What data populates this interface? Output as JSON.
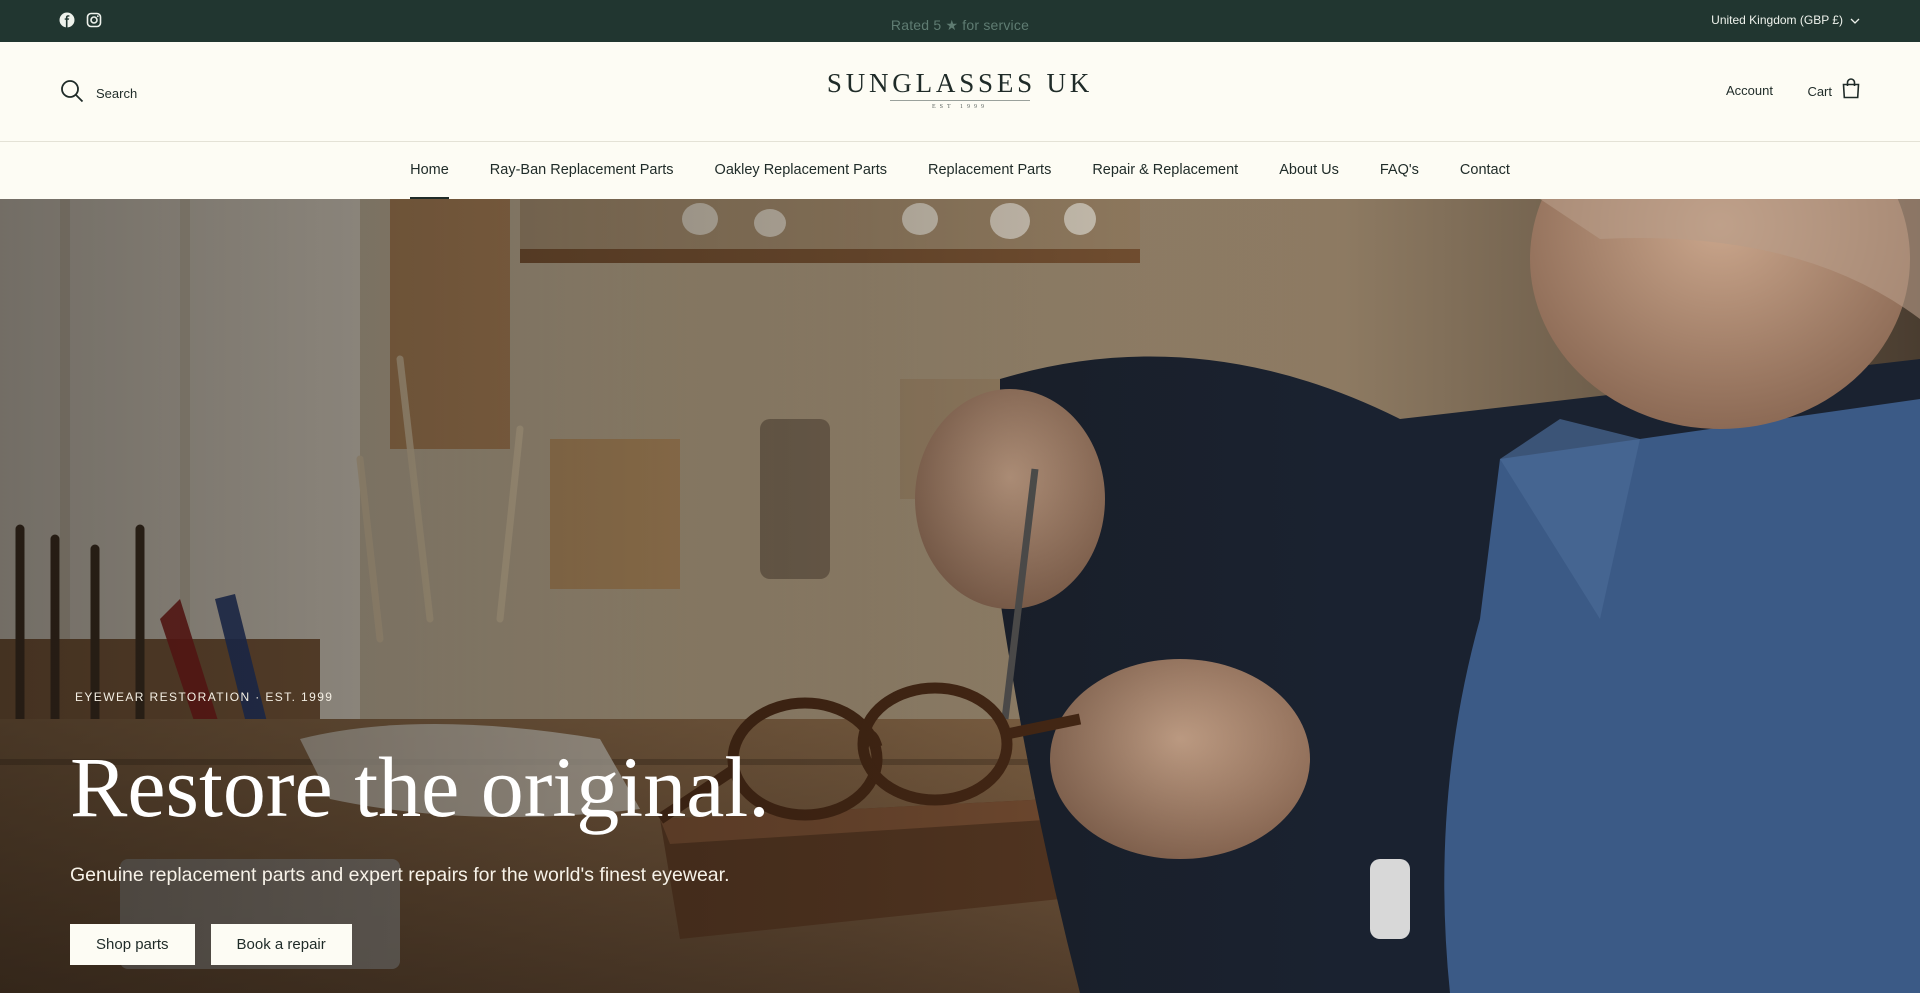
{
  "topbar": {
    "social": [
      {
        "icon": "facebook-icon"
      },
      {
        "icon": "instagram-icon"
      }
    ],
    "announcement": "Rated 5 ★ for service",
    "locale": "United Kingdom (GBP £)",
    "colors": {
      "background": "#213630",
      "announcement": "#5f7c72"
    }
  },
  "header": {
    "search_label": "Search",
    "logo_name": "SUNGLASSES UK",
    "logo_est": "EST 1999",
    "account_label": "Account",
    "cart_label": "Cart"
  },
  "nav": {
    "items": [
      {
        "label": "Home",
        "active": true
      },
      {
        "label": "Ray-Ban Replacement Parts"
      },
      {
        "label": "Oakley Replacement Parts"
      },
      {
        "label": "Replacement Parts"
      },
      {
        "label": "Repair & Replacement"
      },
      {
        "label": "About Us"
      },
      {
        "label": "FAQ's"
      },
      {
        "label": "Contact"
      }
    ]
  },
  "hero": {
    "eyebrow": "EYEWEAR RESTORATION · EST. 1999",
    "title": "Restore the original.",
    "subtitle": "Genuine replacement parts and expert repairs for the world's finest eyewear.",
    "primary_cta": "Shop parts",
    "secondary_cta": "Book a repair"
  },
  "colors": {
    "page_background": "#fdfcf4",
    "text": "#1f2b28",
    "button_background": "#fdfcf4"
  }
}
